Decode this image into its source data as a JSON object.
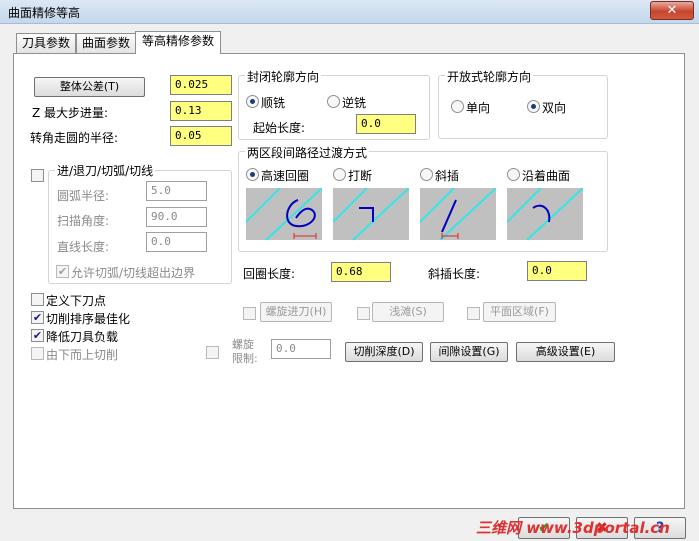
{
  "window": {
    "title": "曲面精修等高",
    "close_glyph": "✕"
  },
  "tabs": [
    {
      "label": "刀具参数"
    },
    {
      "label": "曲面参数"
    },
    {
      "label": "等高精修参数"
    }
  ],
  "left": {
    "tolerance_button": "整体公差(T)",
    "tolerance_value": "0.025",
    "max_step_label": "Z 最大步进量:",
    "max_step_value": "0.13",
    "corner_radius_label": "转角走圆的半径:",
    "corner_radius_value": "0.05"
  },
  "lead": {
    "title": "进/退刀/切弧/切线",
    "arc_radius_label": "圆弧半径:",
    "arc_radius_value": "5.0",
    "sweep_angle_label": "扫描角度:",
    "sweep_angle_value": "90.0",
    "line_length_label": "直线长度:",
    "line_length_value": "0.0",
    "allow_overflow_label": "允许切弧/切线超出边界"
  },
  "closed": {
    "title": "封闭轮廓方向",
    "climb": "顺铣",
    "conventional": "逆铣",
    "start_length_label": "起始长度:",
    "start_length_value": "0.0"
  },
  "open": {
    "title": "开放式轮廓方向",
    "one_way": "单向",
    "two_way": "双向"
  },
  "transition": {
    "title": "两区段间路径过渡方式",
    "options": [
      "高速回圈",
      "打断",
      "斜插",
      "沿着曲面"
    ]
  },
  "loop_length_label": "回圈长度:",
  "loop_length_value": "0.68",
  "ramp_length_label": "斜插长度:",
  "ramp_length_value": "0.0",
  "options": {
    "plunge_label": "定义下刀点",
    "optimize_label": "切削排序最佳化",
    "reduce_load_label": "降低刀具负载",
    "bottom_up_label": "由下而上切削"
  },
  "bottom_buttons": {
    "helix_entry": "螺旋进刀(H)",
    "shallow": "浅滩(S)",
    "flat_area": "平面区域(F)",
    "helix_limit_line1": "螺旋",
    "helix_limit_line2": "限制:",
    "helix_limit_value": "0.0",
    "cut_depth": "切削深度(D)",
    "gap_settings": "间隙设置(G)",
    "advanced": "高级设置(E)"
  },
  "footer": {
    "ok_glyph": "✔",
    "cancel_glyph": "✖",
    "help_glyph": "?",
    "watermark": "三维网 www.3dportal.cn"
  }
}
